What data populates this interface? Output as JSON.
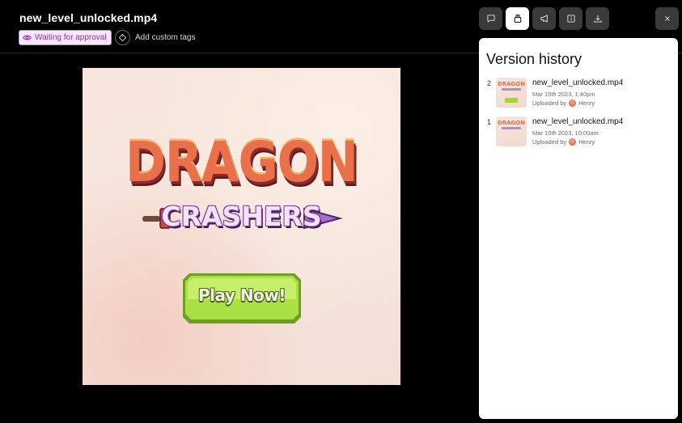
{
  "header": {
    "title": "new_level_unlocked.mp4",
    "status": "Waiting for approval",
    "add_tags": "Add custom tags"
  },
  "toolbar": {
    "buttons": [
      {
        "icon": "comment-icon",
        "active": false
      },
      {
        "icon": "versions-stack-icon",
        "active": true
      },
      {
        "icon": "megaphone-icon",
        "active": false
      },
      {
        "icon": "info-icon",
        "active": false
      },
      {
        "icon": "download-icon",
        "active": false
      }
    ],
    "close_icon": "close-icon"
  },
  "media": {
    "logo_top": "DRAGON",
    "logo_bottom": "CRASHERS",
    "play_button": "Play Now!"
  },
  "version_history": {
    "title": "Version history",
    "items": [
      {
        "number": "2",
        "filename": "new_level_unlocked.mp4",
        "date": "Mar 15th 2023, 1:40pm",
        "uploaded_by_label": "Uploaded by",
        "uploader": "Henry"
      },
      {
        "number": "1",
        "filename": "new_level_unlocked.mp4",
        "date": "Mar 15th 2023, 10:00am",
        "uploaded_by_label": "Uploaded by",
        "uploader": "Henry"
      }
    ]
  },
  "colors": {
    "background": "#000000",
    "status_accent": "#9b2bb8",
    "status_bg": "#f7e9fb",
    "toolbar_btn": "#3a3a3a",
    "panel": "#ffffff"
  }
}
